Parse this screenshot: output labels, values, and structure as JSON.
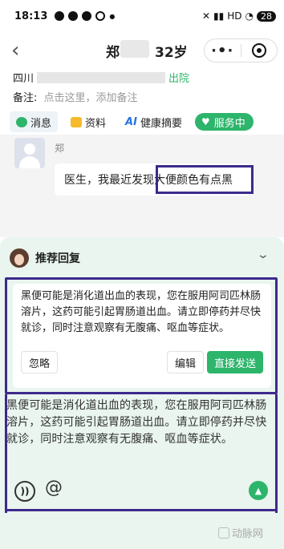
{
  "status_bar": {
    "time": "18:13",
    "network": "HD",
    "battery": "28"
  },
  "nav": {
    "name": "郑",
    "age": "32岁",
    "more_icon": "more-dots-icon",
    "close_icon": "target-circle-icon"
  },
  "patient": {
    "location_prefix": "四川",
    "discharge_status": "出院",
    "note_label": "备注:",
    "note_placeholder": "点击这里，添加备注"
  },
  "tabs": [
    {
      "label": "消息",
      "icon": "chat-icon"
    },
    {
      "label": "资料",
      "icon": "document-icon"
    },
    {
      "label": "健康摘要",
      "prefix": "AI"
    }
  ],
  "service_badge": "服务中",
  "chat": {
    "sender_name": "郑",
    "message": "医生，我最近发现大便颜色有点黑"
  },
  "recommend": {
    "title": "推荐回复",
    "suggestion": "黑便可能是消化道出血的表现，您在服用阿司匹林肠溶片，这药可能引起胃肠道出血。请立即停药并尽快就诊，同时注意观察有无腹痛、呕血等症状。",
    "ignore_label": "忽略",
    "edit_label": "编辑",
    "send_label": "直接发送"
  },
  "input": {
    "text": "黑便可能是消化道出血的表现，您在服用阿司匹林肠溶片，这药可能引起胃肠道出血。请立即停药并尽快就诊，同时注意观察有无腹痛、呕血等症状。"
  },
  "watermark": "动脉网",
  "colors": {
    "accent_green": "#2db56b",
    "highlight_purple": "#3c2a8c",
    "ai_blue": "#2673e6"
  }
}
